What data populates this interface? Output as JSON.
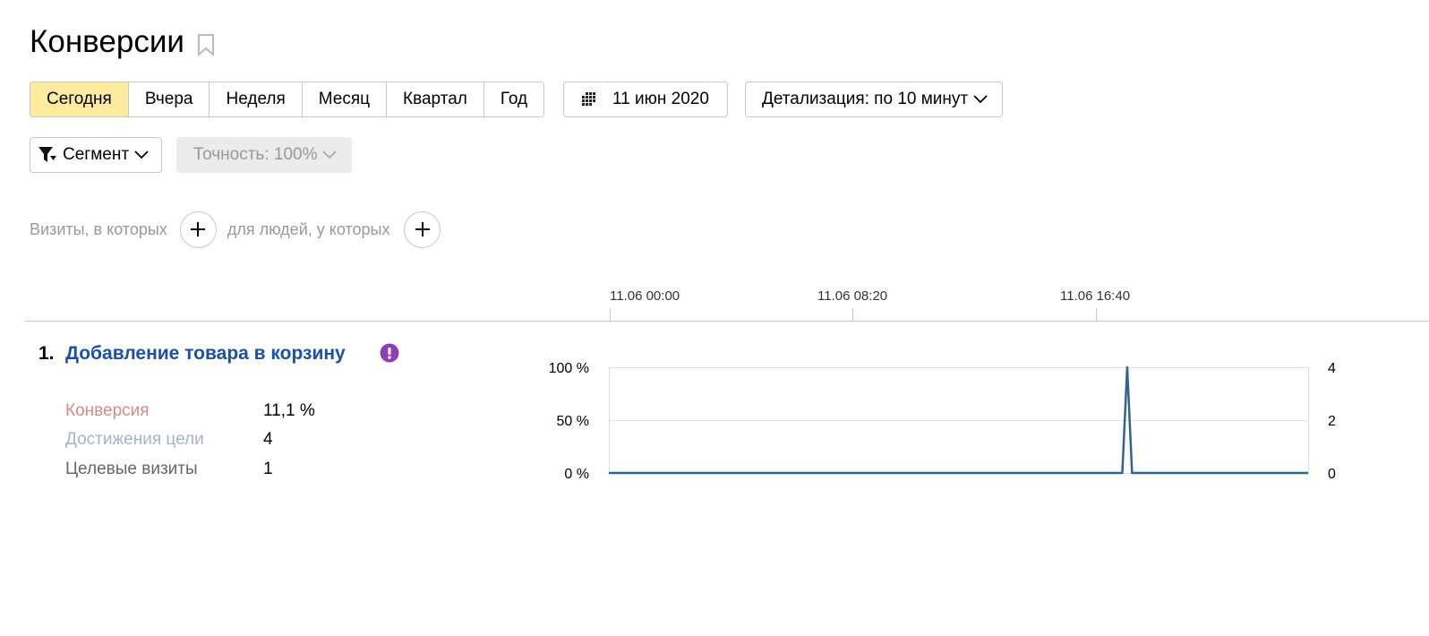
{
  "page": {
    "title": "Конверсии"
  },
  "period": {
    "buttons": [
      "Сегодня",
      "Вчера",
      "Неделя",
      "Месяц",
      "Квартал",
      "Год"
    ],
    "active": "Сегодня",
    "date": "11 июн 2020",
    "detail": "Детализация: по 10 минут"
  },
  "filters": {
    "segment": "Сегмент",
    "accuracy": "Точность: 100%",
    "visits_label": "Визиты, в которых",
    "people_label": "для людей, у которых"
  },
  "timeline": {
    "ticks": [
      "11.06 00:00",
      "11.06 08:20",
      "11.06 16:40"
    ]
  },
  "goal": {
    "number": "1.",
    "title": "Добавление товара в корзину",
    "metrics": [
      {
        "label": "Конверсия",
        "value": "11,1 %",
        "color": "#d48a8a"
      },
      {
        "label": "Достижения цели",
        "value": "4",
        "color": "#a7b4c6"
      },
      {
        "label": "Целевые визиты",
        "value": "1",
        "color": "#666666"
      }
    ]
  },
  "colors": {
    "active_period": "#ffeba0",
    "link": "#1c4fa8",
    "warning": "#8e3fb5",
    "series": "#2f6593"
  },
  "chart_data": {
    "type": "line",
    "x_range": [
      "11.06 00:00",
      "11.06 23:50"
    ],
    "interval_minutes": 10,
    "points_total": 144,
    "y_left_ticks": [
      "100 %",
      "50 %",
      "0 %"
    ],
    "y_right_ticks": [
      "4",
      "2",
      "0"
    ],
    "ylim_left": [
      0,
      100
    ],
    "ylim_right": [
      0,
      4
    ],
    "grid": true,
    "series": [
      {
        "values_nonzero": [
          {
            "x": "11.06 17:40",
            "y": 100
          }
        ],
        "baseline": 0
      }
    ]
  }
}
